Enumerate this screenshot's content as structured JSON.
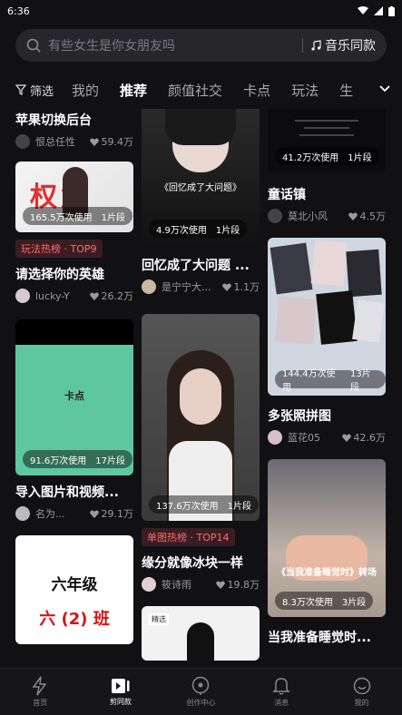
{
  "status_bar": {
    "time": "6:36"
  },
  "search": {
    "placeholder": "有些女生是你女朋友吗",
    "music_label": "音乐同款"
  },
  "tabs": {
    "filter": "筛选",
    "items": [
      "我的",
      "推荐",
      "颜值社交",
      "卡点",
      "玩法",
      "生"
    ]
  },
  "cards": {
    "c1": [
      {
        "title": "苹果切换后台",
        "author": "恨总任性",
        "likes": "59.4万"
      },
      {
        "title": "请选择你的英雄",
        "author": "lucky-Y",
        "likes": "26.2万",
        "uses": "165.5万次使用",
        "segments": "1片段",
        "badge": "玩法热榜 · TOP9",
        "thumb_text": "权武"
      },
      {
        "title": "导入图片和视频...",
        "author": "名为...",
        "likes": "29.1万",
        "uses": "91.6万次使用",
        "segments": "17片段",
        "thumb_text": "卡点"
      },
      {
        "thumb_text_1": "六年级",
        "thumb_text_2": "六 (2) 班"
      }
    ],
    "c2": [
      {
        "title": "回忆成了大问题 ...",
        "author": "是宁宁大...",
        "likes": "1.1万",
        "uses": "4.9万次使用",
        "segments": "1片段",
        "thumb_text": "《回忆成了大问题》"
      },
      {
        "title": "缘分就像冰块一样",
        "author": "筱诗雨",
        "likes": "19.8万",
        "uses": "137.6万次使用",
        "segments": "1片段",
        "badge": "单图热榜 · TOP14"
      },
      {
        "tag": "精选"
      }
    ],
    "c3": [
      {
        "title": "童话镇",
        "author": "莫北小风",
        "likes": "4.5万",
        "uses": "41.2万次使用",
        "segments": "1片段"
      },
      {
        "title": "多张照拼图",
        "author": "蓝花05",
        "likes": "42.6万",
        "uses": "144.4万次使用",
        "segments": "13片段"
      },
      {
        "title": "当我准备睡觉时...",
        "uses": "8.3万次使用",
        "segments": "3片段",
        "thumb_text": "《当我准备睡觉时》转场"
      }
    ]
  },
  "bottom_nav": [
    "首页",
    "剪同款",
    "创作中心",
    "消息",
    "我的"
  ]
}
